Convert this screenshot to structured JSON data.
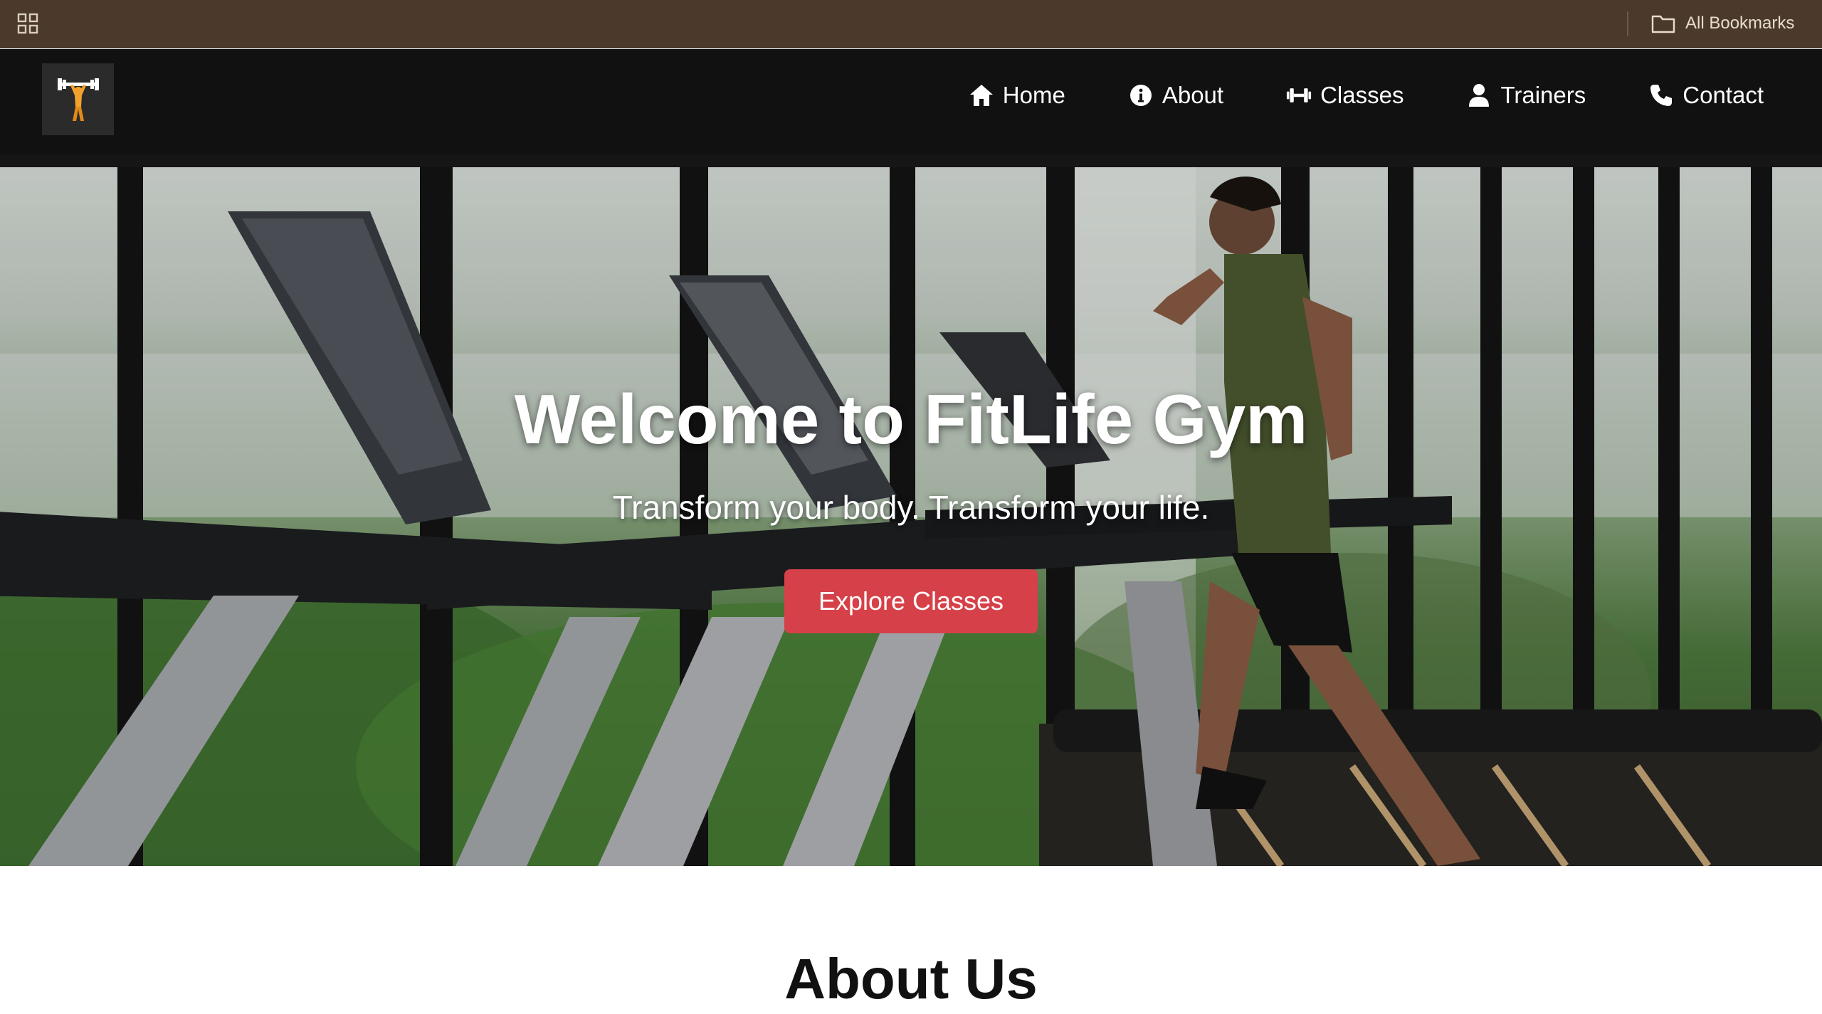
{
  "bookmarks_bar": {
    "apps_icon": "grid-icon",
    "all_bookmarks_label": "All Bookmarks",
    "folder_icon": "folder-icon"
  },
  "header": {
    "logo_icon": "weightlifter-logo",
    "nav": [
      {
        "label": "Home",
        "icon": "home-icon"
      },
      {
        "label": "About",
        "icon": "info-icon"
      },
      {
        "label": "Classes",
        "icon": "dumbbell-icon"
      },
      {
        "label": "Trainers",
        "icon": "user-icon"
      },
      {
        "label": "Contact",
        "icon": "phone-icon"
      }
    ]
  },
  "hero": {
    "title": "Welcome to FitLife Gym",
    "subtitle": "Transform your body. Transform your life.",
    "cta_label": "Explore Classes",
    "cta_color": "#d64048"
  },
  "about": {
    "title": "About Us"
  },
  "colors": {
    "bookmarks_bar": "#4b3a2b",
    "header_bg": "#111111",
    "logo_bg": "#2b2b2b",
    "accent": "#d64048"
  }
}
